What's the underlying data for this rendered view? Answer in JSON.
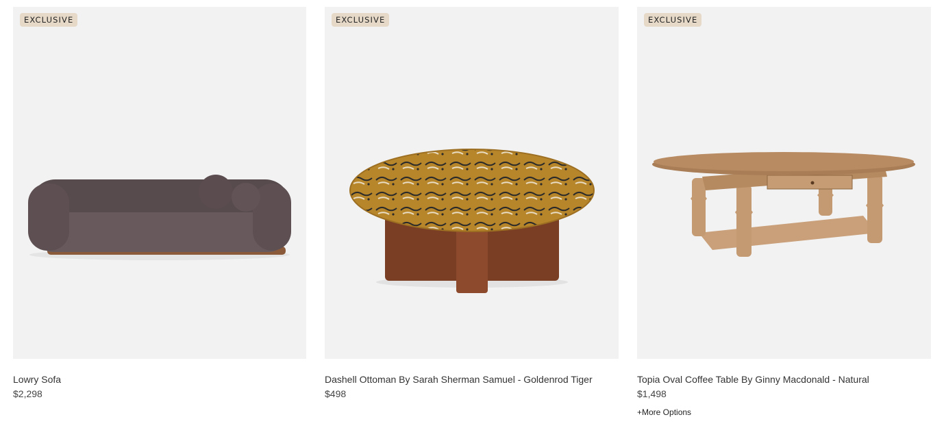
{
  "products": [
    {
      "badge": "EXCLUSIVE",
      "name": "Lowry Sofa",
      "price": "$2,298",
      "image_icon": "sofa-image"
    },
    {
      "badge": "EXCLUSIVE",
      "name": "Dashell Ottoman By Sarah Sherman Samuel - Goldenrod Tiger",
      "price": "$498",
      "image_icon": "ottoman-image"
    },
    {
      "badge": "EXCLUSIVE",
      "name": "Topia Oval Coffee Table By Ginny Macdonald - Natural",
      "price": "$1,498",
      "more_options": "+More Options",
      "image_icon": "coffee-table-image"
    }
  ],
  "colors": {
    "badge_bg": "#e6d9c8",
    "tile_bg": "#f2f2f2"
  }
}
